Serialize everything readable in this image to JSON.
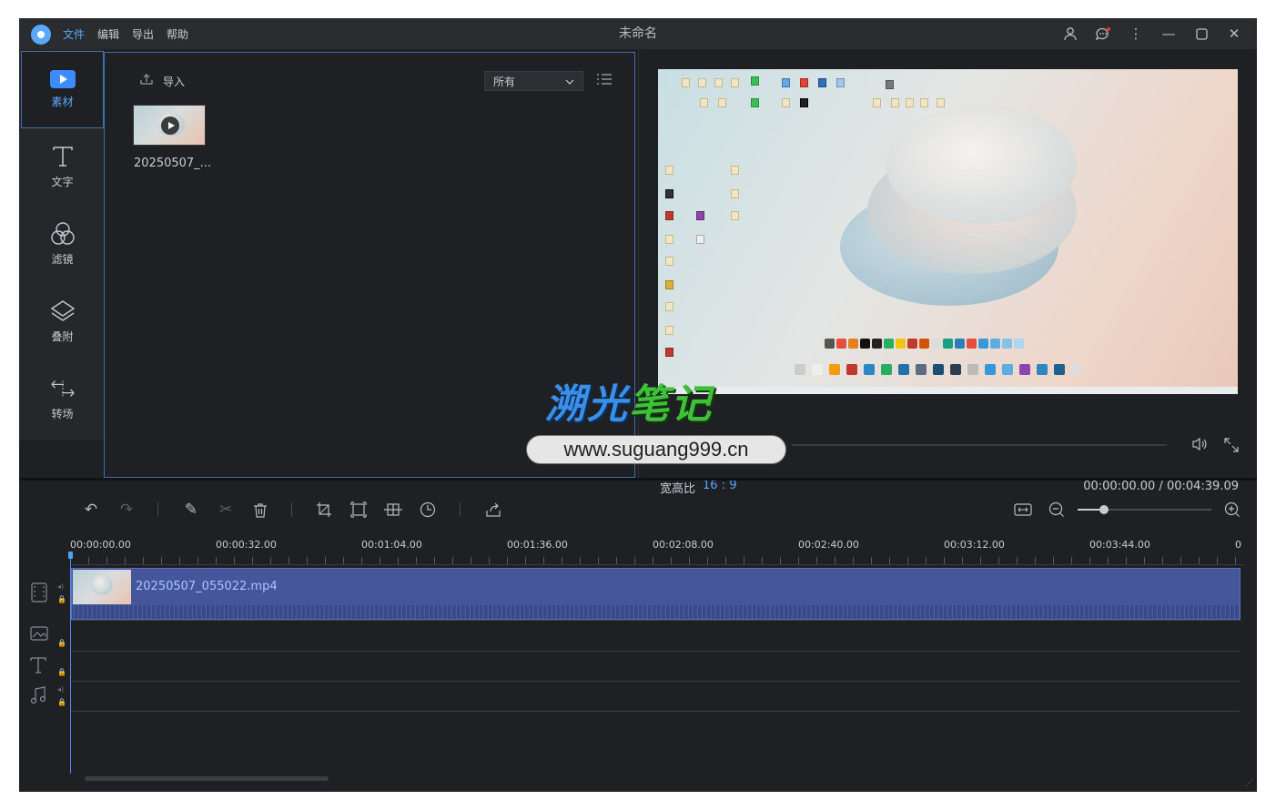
{
  "window": {
    "title": "未命名"
  },
  "menu": [
    {
      "label": "文件",
      "active": true
    },
    {
      "label": "编辑",
      "active": false
    },
    {
      "label": "导出",
      "active": false
    },
    {
      "label": "帮助",
      "active": false
    }
  ],
  "titlebar_icons": [
    "user-icon",
    "feedback-icon",
    "more-icon",
    "minimize-icon",
    "maximize-icon",
    "close-icon"
  ],
  "sidebar": {
    "items": [
      {
        "label": "素材",
        "icon": "media-icon",
        "active": true
      },
      {
        "label": "文字",
        "icon": "text-icon",
        "active": false
      },
      {
        "label": "滤镜",
        "icon": "filter-icon",
        "active": false
      },
      {
        "label": "叠附",
        "icon": "overlay-icon",
        "active": false
      },
      {
        "label": "转场",
        "icon": "transition-icon",
        "active": false
      }
    ]
  },
  "media": {
    "import_label": "导入",
    "filter_value": "所有",
    "items": [
      {
        "name": "20250507_..."
      }
    ]
  },
  "preview": {
    "ratio_label": "宽高比",
    "ratio_value": "16 : 9",
    "current_time": "00:00:00.00",
    "total_time": "00:04:39.09",
    "time_separator": " / ",
    "progress": 0
  },
  "watermark": {
    "part1": "溯光",
    "part2": "笔记",
    "url": "www.suguang999.cn"
  },
  "timeline": {
    "ruler_labels": [
      "00:00:00.00",
      "00:00:32.00",
      "00:01:04.00",
      "00:01:36.00",
      "00:02:08.00",
      "00:02:40.00",
      "00:03:12.00",
      "00:03:44.00",
      "0"
    ],
    "clip_name": "20250507_055022.mp4",
    "zoom_level": 0.2
  },
  "colors": {
    "accent": "#5aa8ff",
    "clip": "#45579a",
    "background": "#1f2023"
  }
}
